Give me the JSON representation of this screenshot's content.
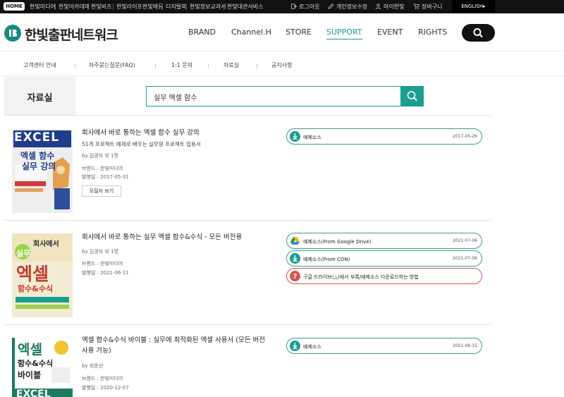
{
  "topbar": {
    "home": "HOME",
    "sites": [
      "한빛미디어",
      "한빛아카데미",
      "한빛비즈",
      "한빛라이프",
      "한빛에듀",
      "디지털북",
      "한빛정보교과서",
      "한빛대관서비스"
    ],
    "logout": "로그아웃",
    "privacy": "개인정보수정",
    "mypage": "마이한빛",
    "cart": "장바구니",
    "english": "ENGLISH▸"
  },
  "header": {
    "logo_text": "한빛출판네트워크",
    "menu": [
      "BRAND",
      "Channel.H",
      "STORE",
      "SUPPORT",
      "EVENT",
      "RIGHTS"
    ],
    "active_menu": "SUPPORT"
  },
  "subnav": [
    "고객센터 안내",
    "자주묻는질문(FAQ)",
    "1:1 문의",
    "자료실",
    "공지사항"
  ],
  "page_title": "자료실",
  "search": {
    "value": "실무 엑셀 함수"
  },
  "books": [
    {
      "title": "회사에서 바로 통하는 엑셀 함수 실무 강의",
      "desc": "51개 프로젝트 예제로 배우는 실무형 프로젝트 업용서",
      "author": "by 김경자 외 1명",
      "brand": "브랜드 : 한빛미디어",
      "date": "발행일 : 2017-05-31",
      "preview": "모릴자 보기",
      "cover": {
        "l1": "EXCEL",
        "l2": "엑셀 함수",
        "l3": "실무 강의"
      },
      "downloads": [
        {
          "label": "예제소스",
          "date": "2017-05-29",
          "icon": "download-icon",
          "style": "normal"
        }
      ]
    },
    {
      "title": "회사에서 바로 통하는 실무 엑셀 함수&수식 - 모든 버전용",
      "author": "by 김경자 외 1명",
      "brand": "브랜드 : 한빛미디어",
      "date": "발행일 : 2021-06-11",
      "cover": {
        "l1": "회사에서",
        "l2": "실무",
        "l3": "엑셀",
        "l4": "함수&수식"
      },
      "downloads": [
        {
          "label": "예제소스(From Google Drive)",
          "date": "2021-07-06",
          "icon": "google-drive-icon",
          "style": "normal"
        },
        {
          "label": "예제소스(From CDN)",
          "date": "2021-07-06",
          "icon": "download-icon",
          "style": "normal"
        },
        {
          "label": "구글 드라이브(△)에서 부록/예제소스 다운로드하는 방법",
          "date": "",
          "icon": "help-icon",
          "style": "red"
        }
      ]
    },
    {
      "title": "엑셀 함수&수식 바이블 : 실무에 최적화된 엑셀 사용서 (모든 버전 사용 가능)",
      "author": "by 최준선",
      "brand": "브랜드 : 한빛미디어",
      "date": "발행일 : 2020-12-07",
      "cover": {
        "l1": "엑셀",
        "l2": "함수&수식",
        "l3": "바이블",
        "l4": "EXCEL"
      },
      "downloads": [
        {
          "label": "예제소스",
          "date": "2021-06-15",
          "icon": "download-icon",
          "style": "normal"
        }
      ]
    }
  ],
  "colors": {
    "accent": "#1a9e8f",
    "dark": "#111111",
    "danger": "#d9534f"
  }
}
